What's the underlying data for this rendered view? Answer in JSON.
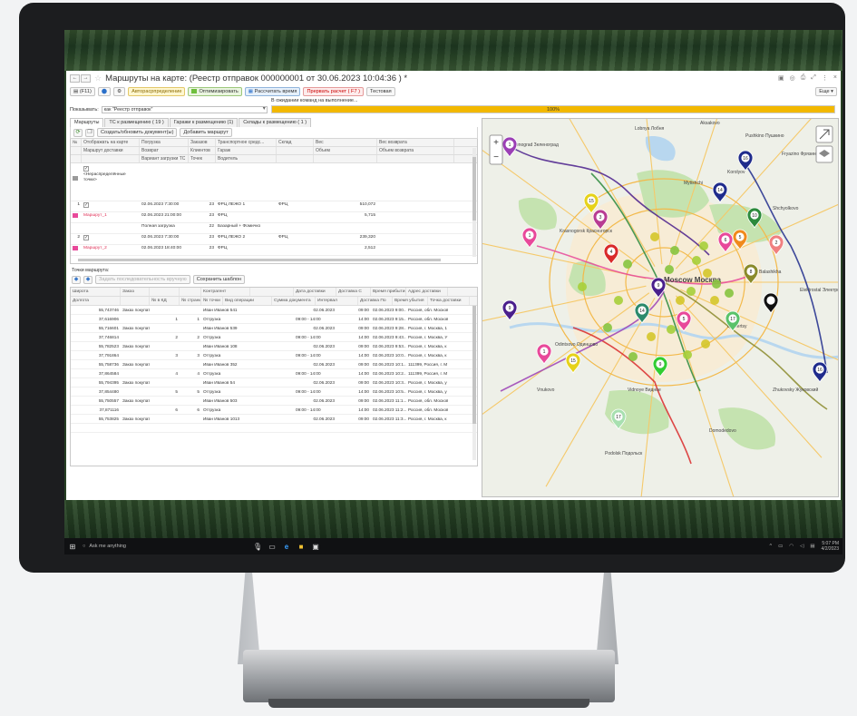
{
  "app": {
    "title": "Маршруты на карте:  (Реестр отправок 000000001 от 30.06.2023 10:04:36 ) *",
    "nav_back": "←",
    "nav_forward": "→",
    "more_label": "Еще ▾",
    "toolbar": {
      "f11": "F11",
      "distribute": "Авторасрпределение",
      "optimize": "Оптимизировать",
      "calc_time": "Рассчитать время",
      "stop_calc": "Прервать расчет ( F7 )",
      "test": "Тестовая"
    },
    "status": "В ожидании команд на выполнение...",
    "show_label": "Показывать:",
    "show_value": "как \"Реестр отправок\"",
    "progress_percent": 100,
    "progress_label": "100%"
  },
  "tabs": [
    {
      "label": "Маршруты"
    },
    {
      "label": "ТС к размещению ( 19 )"
    },
    {
      "label": "Гаражи к размещению (1)"
    },
    {
      "label": "Склады к размещению ( 1 )"
    }
  ],
  "routes_toolbar": {
    "create_docs": "Создать/обновить документ(ы)",
    "add_route": "Добавить маршрут"
  },
  "routes_table": {
    "headers": [
      [
        "№",
        "Отображать на карте",
        "Погрузка",
        "Заказов",
        "Транспортное средс...",
        "Склад",
        "Вес",
        "Вес возврата"
      ],
      [
        "",
        "Маршрут доставки",
        "Возврат",
        "Клиентов",
        "Гараж",
        "",
        "Объем",
        "Объем возврата"
      ],
      [
        "",
        "",
        "Вариант загрузки ТС",
        "Точек",
        "Водитель",
        "",
        "",
        ""
      ]
    ],
    "unassigned_label": "<Нераспределённые точки>",
    "rows": [
      {
        "num": "1",
        "name": "Маршрут_1",
        "color": "#e8499a",
        "load": "02.06.2023 7:30:00",
        "ret": "02.06.2023 21:00:00",
        "variant": "Полная загрузка",
        "orders": "23",
        "clients": "23",
        "points": "22",
        "vehicle": "ФРЦ ЛЕЖО 1",
        "garage": "ФРЦ",
        "driver": "Базарный + Фомичко",
        "warehouse": "ФРЦ",
        "weight": "510,072",
        "volume": "5,715"
      },
      {
        "num": "2",
        "name": "Маршрут_2",
        "color": "#e8499a",
        "load": "02.06.2023 7:30:00",
        "ret": "02.06.2023 18:40:00",
        "variant": "",
        "orders": "23",
        "clients": "23",
        "points": "",
        "vehicle": "ФРЦ ЛЕЖО 2",
        "garage": "ФРЦ",
        "driver": "",
        "warehouse": "ФРЦ",
        "weight": "239,320",
        "volume": "2,512"
      }
    ]
  },
  "points_section": {
    "title": "Точки маршрута:",
    "set_sequence": "Задать последовательность вручную",
    "save_template": "Сохранить шаблон"
  },
  "points_table": {
    "headers": [
      [
        "Широта",
        "Заказ",
        "",
        "",
        "Контрагент",
        "",
        "Дата доставки",
        "Доставка С",
        "Время прибытия",
        "Адрес доставки"
      ],
      [
        "Долгота",
        "",
        "№ в КД",
        "№ страны",
        "№ точки",
        "Вид операции",
        "Сумма документа",
        "Интервал",
        "Доставка По",
        "Время убытия",
        "Точка доставки"
      ]
    ],
    "rows": [
      {
        "lat": "55,743746",
        "lon": "37,616906",
        "order": "Заказ покупателя 000000000541 от...",
        "kd": "1",
        "country": "1",
        "counterparty": "Иван Иванов 541",
        "op": "Отгрузка",
        "date": "02.06.2023",
        "interval": "09:00 - 14:00",
        "from": "09:00",
        "to": "14:00",
        "arrive": "02.06.2023 9:00...",
        "depart": "02.06.2023 9:15...",
        "addr": "Россия, обл. Москов",
        "addr2": "Россия, обл. Москов"
      },
      {
        "lat": "55,716601",
        "lon": "37,746814",
        "order": "Заказ покупателя 000000000539 от...",
        "kd": "2",
        "country": "2",
        "counterparty": "Иван Иванов 539",
        "op": "Отгрузка",
        "date": "02.06.2023",
        "interval": "09:00 - 14:00",
        "from": "09:00",
        "to": "14:00",
        "arrive": "02.06.2023 9:28...",
        "depart": "02.06.2023 9:43...",
        "addr": "Россия, г. Москва, 1",
        "addr2": "Россия, г. Москва, У"
      },
      {
        "lat": "55,782523",
        "lon": "37,791864",
        "order": "Заказ покупателя 000000000108 от...",
        "kd": "3",
        "country": "3",
        "counterparty": "Иван Иванов 108",
        "op": "Отгрузка",
        "date": "02.06.2023",
        "interval": "09:00 - 14:00",
        "from": "09:00",
        "to": "14:00",
        "arrive": "02.06.2023 9:53...",
        "depart": "02.06.2023 10:0...",
        "addr": "Россия, г. Москва, к",
        "addr2": "Россия, г. Москва, к"
      },
      {
        "lat": "55,758736",
        "lon": "37,864584",
        "order": "Заказ покупателя 000000000352 от...",
        "kd": "4",
        "country": "4",
        "counterparty": "Иван Иванов 352",
        "op": "Отгрузка",
        "date": "02.06.2023",
        "interval": "09:00 - 14:00",
        "from": "09:00",
        "to": "14:00",
        "arrive": "02.06.2023 10:1...",
        "depart": "02.06.2023 10:2...",
        "addr": "111399, Россия, г. М",
        "addr2": "111399, Россия, г. М"
      },
      {
        "lat": "55,794395",
        "lon": "37,854480",
        "order": "Заказ покупателя 000000000054 от...",
        "kd": "5",
        "country": "5",
        "counterparty": "Иван Иванов 54",
        "op": "Отгрузка",
        "date": "02.06.2023",
        "interval": "09:00 - 14:00",
        "from": "09:00",
        "to": "14:00",
        "arrive": "02.06.2023 10:3...",
        "depart": "02.06.2023 10:5...",
        "addr": "Россия, г. Москва, у",
        "addr2": "Россия, г. Москва, у"
      },
      {
        "lat": "55,750557",
        "lon": "37,871116",
        "order": "Заказ покупателя 000000000503 от...",
        "kd": "6",
        "country": "6",
        "counterparty": "Иван Иванов 503",
        "op": "Отгрузка",
        "date": "02.06.2023",
        "interval": "09:00 - 14:00",
        "from": "09:00",
        "to": "14:00",
        "arrive": "02.06.2023 11:1...",
        "depart": "02.06.2023 11:2...",
        "addr": "Россия, обл. Москов",
        "addr2": "Россия, обл. Москов"
      },
      {
        "lat": "55,753825",
        "lon": "",
        "order": "Заказ покупателя 000000001013 от...",
        "kd": "",
        "country": "",
        "counterparty": "Иван Иванов 1013",
        "op": "",
        "date": "02.06.2023",
        "interval": "",
        "from": "09:00",
        "to": "",
        "arrive": "02.06.2023 11:3...",
        "depart": "",
        "addr": "Россия, г. Москва, к",
        "addr2": ""
      }
    ]
  },
  "map": {
    "labels": [
      {
        "text": "Lobnya Лобня"
      },
      {
        "text": "Pushkino Пушкино"
      },
      {
        "text": "Mytishchi"
      },
      {
        "text": "Korolyov"
      },
      {
        "text": "Shchyolkovo"
      },
      {
        "text": "Krasnogorsk Красногорск"
      },
      {
        "text": "Moscow Москва"
      },
      {
        "text": "Balashikha"
      },
      {
        "text": "Lyubertsy"
      },
      {
        "text": "Odintsovo Одинцово"
      },
      {
        "text": "Vnukovo"
      },
      {
        "text": "Vidnoye Видное"
      },
      {
        "text": "Podolsk Подольск"
      },
      {
        "text": "Zhukovsky Жуковский"
      },
      {
        "text": "Domodedovo"
      },
      {
        "text": "Elektrostal Электросталь"
      },
      {
        "text": "Fryazino Фрязино"
      },
      {
        "text": "Zelenograd Зеленоград"
      },
      {
        "text": "Aksakovo"
      }
    ],
    "colors": {
      "water": "#b8d7ef",
      "land": "#eef0e8",
      "park": "#c5e3b0",
      "city": "#f7ecd6"
    },
    "pins": [
      {
        "n": "1",
        "c": "#9b3fb5"
      },
      {
        "n": "16",
        "c": "#1f2b8c"
      },
      {
        "n": "15",
        "c": "#e6d21a"
      },
      {
        "n": "3",
        "c": "#b83c92"
      },
      {
        "n": "10",
        "c": "#2c8a3c"
      },
      {
        "n": "14",
        "c": "#1f2b8c"
      },
      {
        "n": "1",
        "c": "#e8499a"
      },
      {
        "n": "4",
        "c": "#d92a2a"
      },
      {
        "n": "6",
        "c": "#e8499a"
      },
      {
        "n": "2",
        "c": "#f08080"
      },
      {
        "n": "5",
        "c": "#f08a1c"
      },
      {
        "n": "8",
        "c": "#8a8a2a"
      },
      {
        "n": "9",
        "c": "#4a1f8c"
      },
      {
        "n": "14",
        "c": "#2c8a6c"
      },
      {
        "n": "5",
        "c": "#e8499a"
      },
      {
        "n": "17",
        "c": "#5ac26a"
      },
      {
        "n": "",
        "c": "#111111"
      },
      {
        "n": "1",
        "c": "#e8499a"
      },
      {
        "n": "15",
        "c": "#e6d21a"
      },
      {
        "n": "9",
        "c": "#32cd32"
      },
      {
        "n": "17",
        "c": "#a8e0b0"
      },
      {
        "n": "16",
        "c": "#1f2b8c"
      },
      {
        "n": "9",
        "c": "#4a1f8c"
      }
    ]
  },
  "taskbar": {
    "search": "Ask me anything",
    "time": "5:07 PM",
    "date": "4/2/2023"
  }
}
